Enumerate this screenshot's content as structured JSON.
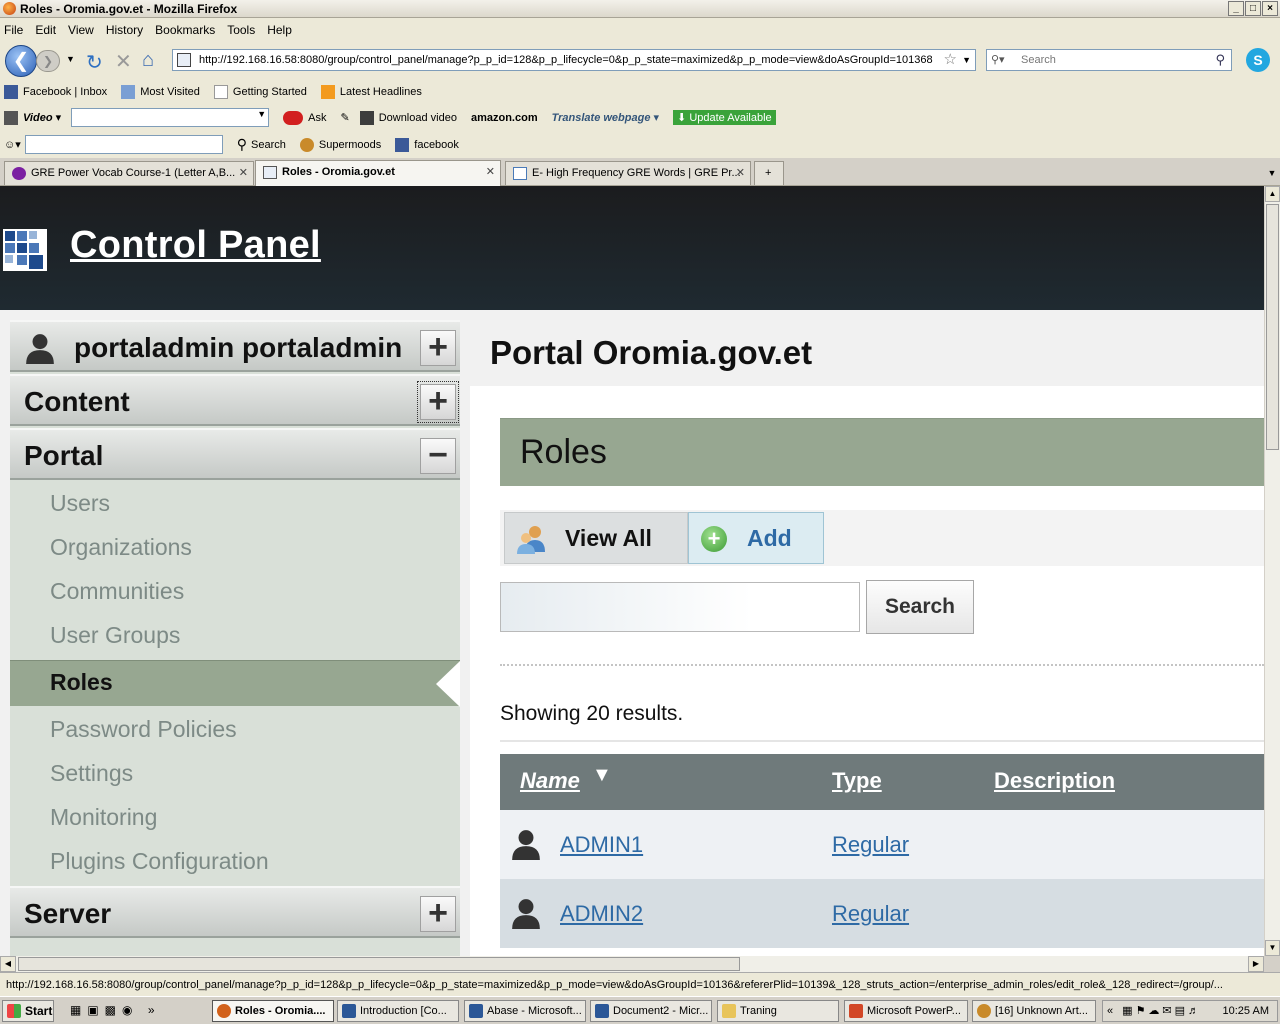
{
  "window": {
    "title": "Roles - Oromia.gov.et - Mozilla Firefox"
  },
  "menu": [
    "File",
    "Edit",
    "View",
    "History",
    "Bookmarks",
    "Tools",
    "Help"
  ],
  "nav": {
    "url": "http://192.168.16.58:8080/group/control_panel/manage?p_p_id=128&p_p_lifecycle=0&p_p_state=maximized&p_p_mode=view&doAsGroupId=101368",
    "search_placeholder": "Search"
  },
  "bookmarks": [
    "Facebook | Inbox",
    "Most Visited",
    "Getting Started",
    "Latest Headlines"
  ],
  "toolbar2": {
    "video": "Video",
    "ask": "Ask",
    "download": "Download video",
    "amazon": "amazon.com",
    "translate": "Translate webpage",
    "update": "Update Available"
  },
  "toolbar3": {
    "search": "Search",
    "supermoods": "Supermoods",
    "facebook": "facebook"
  },
  "tabs": [
    {
      "label": "GRE Power Vocab Course-1 (Letter A,B..."
    },
    {
      "label": "Roles - Oromia.gov.et"
    },
    {
      "label": "E- High Frequency GRE Words | GRE Pr..."
    }
  ],
  "header": {
    "title": "Control Panel"
  },
  "sidebar": {
    "user": "portaladmin portaladmin",
    "content": "Content",
    "portal": "Portal",
    "items": [
      "Users",
      "Organizations",
      "Communities",
      "User Groups",
      "Roles",
      "Password Policies",
      "Settings",
      "Monitoring",
      "Plugins Configuration"
    ],
    "server": "Server"
  },
  "main": {
    "portal_title": "Portal Oromia.gov.et",
    "section_title": "Roles",
    "view_all": "View All",
    "add": "Add",
    "search_button": "Search",
    "showing": "Showing 20 results.",
    "columns": {
      "name": "Name",
      "type": "Type",
      "description": "Description"
    },
    "rows": [
      {
        "name": "ADMIN1",
        "type": "Regular"
      },
      {
        "name": "ADMIN2",
        "type": "Regular"
      }
    ]
  },
  "status": {
    "text": "http://192.168.16.58:8080/group/control_panel/manage?p_p_id=128&p_p_lifecycle=0&p_p_state=maximized&p_p_mode=view&doAsGroupId=10136&refererPlid=10139&_128_struts_action=/enterprise_admin_roles/edit_role&_128_redirect=/group/..."
  },
  "taskbar": {
    "start": "Start",
    "items": [
      "Roles - Oromia....",
      "Introduction [Co...",
      "Abase - Microsoft...",
      "Document2 - Micr...",
      "Traning",
      "Microsoft PowerP...",
      "[16] Unknown Art..."
    ],
    "clock": "10:25 AM"
  },
  "colors": {
    "sidebar_selected": "#97a791",
    "link": "#2e6aa5",
    "header_bg": "#1b1c1e"
  }
}
